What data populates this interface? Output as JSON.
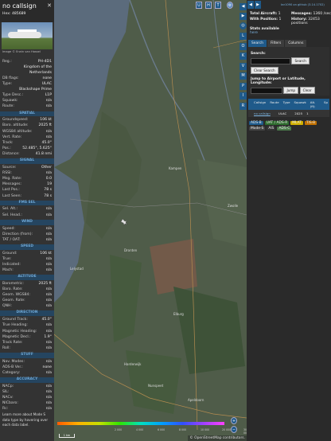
{
  "aircraft": {
    "callsign": "no callsign",
    "hex_label": "Hex:",
    "hex": "485689",
    "close_icon": "close-icon",
    "photo_credit": "Image © Erwin van Hassel"
  },
  "info_rows": [
    {
      "k": "Reg.:",
      "v": "PH-4D1"
    },
    {
      "k": "",
      "v": "Kingdom of the Netherlands"
    },
    {
      "k": "DB flags:",
      "v": "none"
    },
    {
      "k": "Type:",
      "v": "ULAC"
    },
    {
      "k": "",
      "v": "Blackshape Prime"
    },
    {
      "k": "Type Desc.:",
      "v": "L1P"
    },
    {
      "k": "Squawk:",
      "v": "n/a"
    },
    {
      "k": "Route:",
      "v": "n/a"
    }
  ],
  "sections": [
    {
      "title": "SPATIAL",
      "rows": [
        {
          "k": "Groundspeed:",
          "v": "106 kt"
        },
        {
          "k": "Baro. altitude:",
          "v": "2025 ft"
        },
        {
          "k": "WGS84 altitude:",
          "v": "n/a"
        },
        {
          "k": "Vert. Rate:",
          "v": "n/a"
        },
        {
          "k": "Track:",
          "v": "45.0°"
        },
        {
          "k": "Pos.:",
          "v": "52.485°, 5.625°"
        },
        {
          "k": "Distance:",
          "v": "41.8 nmi"
        }
      ]
    },
    {
      "title": "SIGNAL",
      "rows": [
        {
          "k": "Source:",
          "v": "Other"
        },
        {
          "k": "RSSI:",
          "v": "n/a"
        },
        {
          "k": "Msg. Rate:",
          "v": "0.0"
        },
        {
          "k": "Messages:",
          "v": "19"
        },
        {
          "k": "Last Pos.:",
          "v": "78 s"
        },
        {
          "k": "Last Seen:",
          "v": "78 s"
        }
      ]
    },
    {
      "title": "FMS SEL",
      "rows": [
        {
          "k": "Sel. Alt.:",
          "v": "n/a"
        },
        {
          "k": "Sel. Head.:",
          "v": "n/a"
        }
      ]
    },
    {
      "title": "WIND",
      "rows": [
        {
          "k": "Speed:",
          "v": "n/a"
        },
        {
          "k": "Direction (from):",
          "v": "n/a"
        },
        {
          "k": "TAT / OAT:",
          "v": "n/a"
        }
      ]
    },
    {
      "title": "SPEED",
      "rows": [
        {
          "k": "Ground:",
          "v": "106 kt"
        },
        {
          "k": "True:",
          "v": "n/a"
        },
        {
          "k": "Indicated:",
          "v": "n/a"
        },
        {
          "k": "Mach:",
          "v": "n/a"
        }
      ]
    },
    {
      "title": "ALTITUDE",
      "rows": [
        {
          "k": "Barometric:",
          "v": "2025 ft"
        },
        {
          "k": "Baro. Rate:",
          "v": "n/a"
        },
        {
          "k": "Geom. WGS84:",
          "v": "n/a"
        },
        {
          "k": "Geom. Rate:",
          "v": "n/a"
        },
        {
          "k": "QNH:",
          "v": "n/a"
        }
      ]
    },
    {
      "title": "DIRECTION",
      "rows": [
        {
          "k": "Ground Track:",
          "v": "45.0°"
        },
        {
          "k": "True Heading:",
          "v": "n/a"
        },
        {
          "k": "Magnetic Heading:",
          "v": "n/a"
        },
        {
          "k": "Magnetic Decl.:",
          "v": "1.9°"
        },
        {
          "k": "Track Rate:",
          "v": "n/a"
        },
        {
          "k": "Roll:",
          "v": "n/a"
        }
      ]
    },
    {
      "title": "STUFF",
      "rows": [
        {
          "k": "Nav. Modes:",
          "v": "n/a"
        },
        {
          "k": "ADS-B Ver.:",
          "v": "none"
        },
        {
          "k": "Category:",
          "v": "n/a"
        }
      ]
    },
    {
      "title": "ACCURACY",
      "rows": [
        {
          "k": "NACp:",
          "v": "n/a"
        },
        {
          "k": "SIL:",
          "v": "n/a"
        },
        {
          "k": "NACv:",
          "v": "n/a"
        },
        {
          "k": "NICbaro:",
          "v": "n/a"
        },
        {
          "k": "Rc:",
          "v": "n/a"
        }
      ]
    }
  ],
  "left_note": "Learn more about Mode S data type by hovering over each data label.",
  "map": {
    "top_buttons": [
      "U",
      "H",
      "T"
    ],
    "right_buttons": [
      "L",
      "O",
      "K",
      "V",
      "M",
      "P",
      "I",
      "R"
    ],
    "attribution": "© OpenStreetMap contributors.",
    "scale_label": "1 km",
    "zoom_in": "+",
    "zoom_out": "−",
    "places": [
      "Kampen",
      "Zwolle",
      "Lelystad",
      "Dronten",
      "Elburg",
      "Harderwijk",
      "Apeldoorn",
      "Nunspeet"
    ],
    "aircraft_icon": "plane-icon",
    "altitude_ticks": [
      "2 000",
      "4 000",
      "6 000",
      "8 000",
      "10 000",
      "20 000",
      "30 000",
      "40 000+"
    ]
  },
  "right": {
    "version": "tar1090 on github (3.14.1702)",
    "stats": [
      {
        "k": "Total Aircraft:",
        "v": "1"
      },
      {
        "k": "Messages:",
        "v": "1360 /sec"
      },
      {
        "k": "With Position:",
        "v": "1"
      },
      {
        "k": "History:",
        "v": "32453 positions"
      },
      {
        "k": "Stats available",
        "v": ""
      }
    ],
    "stats_link": "here",
    "tabs": [
      "Search",
      "Filters",
      "Columns"
    ],
    "search_label": "Search:",
    "search_button": "Search",
    "clear_search": "Clear Search",
    "jump_label": "Jump to Airport or Latitude, Longitude:",
    "jump_button": "Jump",
    "clear_button": "Clear",
    "columns": [
      "",
      "Callsign",
      "Route",
      "Type",
      "Squawk",
      "Alt. (ft)",
      "Sp"
    ],
    "rows": [
      {
        "flag": "",
        "callsign": "no callsign",
        "route": "",
        "type": "ULAC",
        "squawk": "",
        "alt": "2025",
        "sp": "1"
      }
    ],
    "legend": [
      {
        "label": "ADS-B",
        "color": "#1f5a8a"
      },
      {
        "label": "UAT / ADS-R",
        "color": "#2e6b2e"
      },
      {
        "label": "MLAT",
        "color": "#d0b000"
      },
      {
        "label": "TIS-B",
        "color": "#c07000"
      },
      {
        "label": "Mode-S",
        "color": "#444"
      },
      {
        "label": "AIS",
        "color": "#333"
      },
      {
        "label": "ADS-C",
        "color": "#4a7a4a"
      }
    ]
  }
}
